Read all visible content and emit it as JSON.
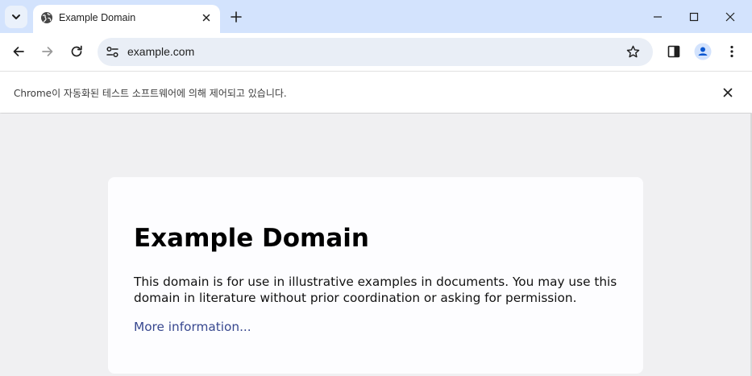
{
  "browser": {
    "tab": {
      "title": "Example Domain"
    },
    "address_bar": {
      "url": "example.com"
    },
    "infobar": {
      "message": "Chrome이 자동화된 테스트 소프트웨어에 의해 제어되고 있습니다."
    },
    "icons": {
      "tab_search": "chevron-down-icon",
      "favicon": "globe-icon",
      "tab_close": "close-icon",
      "new_tab": "plus-icon",
      "minimize": "minimize-icon",
      "maximize": "maximize-icon",
      "window_close": "close-icon",
      "back": "arrow-left-icon",
      "forward": "arrow-right-icon",
      "reload": "reload-icon",
      "site_info": "tune-icon",
      "bookmark": "star-icon",
      "side_panel": "side-panel-icon",
      "profile": "profile-icon",
      "menu": "kebab-menu-icon"
    },
    "colors": {
      "tabstrip": "#d3e3fd",
      "omnibox": "#e9eef6",
      "accent": "#0b57d0"
    }
  },
  "page": {
    "heading": "Example Domain",
    "description": "This domain is for use in illustrative examples in documents. You may use this domain in literature without prior coordination or asking for permission.",
    "link_text": "More information...",
    "colors": {
      "background": "#f0f0f2",
      "card": "#fdfdff",
      "link": "#38488f"
    }
  }
}
